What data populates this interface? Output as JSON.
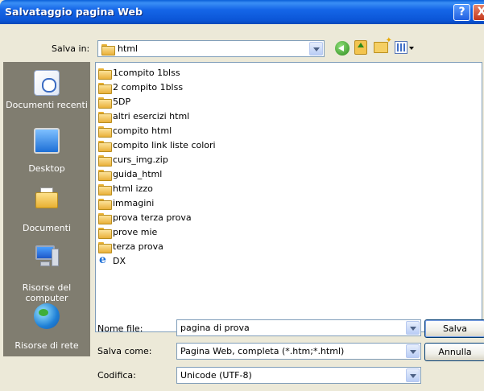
{
  "window": {
    "title": "Salvataggio pagina Web"
  },
  "title_buttons": {
    "help": "?",
    "close": "X"
  },
  "toolbar": {
    "save_in_label": "Salva in:",
    "save_in_value": "html"
  },
  "places": [
    {
      "label": "Documenti recenti",
      "icon": "recent-documents-icon"
    },
    {
      "label": "Desktop",
      "icon": "desktop-icon"
    },
    {
      "label": "Documenti",
      "icon": "my-documents-icon"
    },
    {
      "label": "Risorse del computer",
      "icon": "my-computer-icon"
    },
    {
      "label": "Risorse di rete",
      "icon": "network-places-icon"
    }
  ],
  "files": [
    {
      "name": "1compito 1blss",
      "type": "folder"
    },
    {
      "name": "2 compito 1blss",
      "type": "folder"
    },
    {
      "name": "5DP",
      "type": "folder"
    },
    {
      "name": "altri esercizi html",
      "type": "folder"
    },
    {
      "name": "compito html",
      "type": "folder"
    },
    {
      "name": "compito link liste colori",
      "type": "folder"
    },
    {
      "name": "curs_img.zip",
      "type": "folder"
    },
    {
      "name": "guida_html",
      "type": "folder"
    },
    {
      "name": "html izzo",
      "type": "folder"
    },
    {
      "name": "immagini",
      "type": "folder"
    },
    {
      "name": "prova terza prova",
      "type": "folder"
    },
    {
      "name": "prove mie",
      "type": "folder"
    },
    {
      "name": "terza prova",
      "type": "folder"
    },
    {
      "name": "DX",
      "type": "html-document"
    }
  ],
  "form": {
    "file_name_label": "Nome file:",
    "file_name_value": "pagina di prova",
    "save_as_label": "Salva come:",
    "save_as_value": "Pagina Web, completa (*.htm;*.html)",
    "encoding_label": "Codifica:",
    "encoding_value": "Unicode (UTF-8)"
  },
  "buttons": {
    "save": "Salva",
    "cancel": "Annulla"
  }
}
